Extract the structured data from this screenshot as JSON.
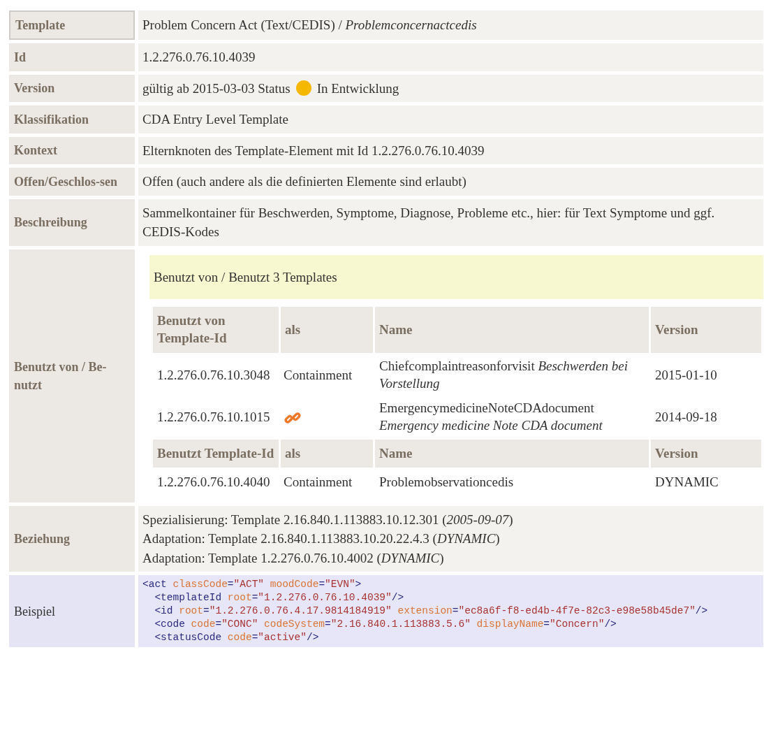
{
  "rows": [
    {
      "kind": "text",
      "label": "Template",
      "text": "Problem Concern Act (Text/CEDIS) / *Problemconcernactcedis*"
    },
    {
      "kind": "text",
      "label": "Id",
      "text": "1.2.276.0.76.10.4039"
    },
    {
      "kind": "status",
      "label": "Version",
      "before": "gültig ab 2015-03-03 Status",
      "color": "#f5b800",
      "after": "In Entwicklung"
    },
    {
      "kind": "text",
      "label": "Klassifikation",
      "text": "CDA Entry Level Template"
    },
    {
      "kind": "text",
      "label": "Kontext",
      "text": "Elternknoten des Template-Element mit Id 1.2.276.0.76.10.4039"
    },
    {
      "kind": "text",
      "label": "Offen/Geschlos-sen",
      "text": "Offen (auch andere als die definierten Elemente sind erlaubt)"
    },
    {
      "kind": "text",
      "label": "Beschreibung",
      "text": "Sammelkontainer für Beschwerden, Symptome, Diagnose, Probleme etc., hier: für Text Symptome und ggf. CEDIS-Kodes"
    },
    {
      "kind": "usage",
      "label": "Benutzt von / Be-nutzt",
      "title": "Benutzt von / Benutzt 3 Templates",
      "groups": [
        {
          "columns": [
            "Benutzt von Template-Id",
            "als",
            "Name",
            "Version"
          ],
          "rows": [
            {
              "id": "1.2.276.0.76.10.3048",
              "as": {
                "kind": "text",
                "text": "Containment"
              },
              "name": "Chiefcomplaintreasonforvisit *Beschwerden bei Vorstellung*",
              "version": "2015-01-10"
            },
            {
              "id": "1.2.276.0.76.10.1015",
              "as": {
                "kind": "link-icon"
              },
              "name": "EmergencymedicineNoteCDAdocument *Emergency medicine Note CDA document*",
              "version": "2014-09-18"
            }
          ]
        },
        {
          "columns": [
            "Benutzt Template-Id",
            "als",
            "Name",
            "Version"
          ],
          "rows": [
            {
              "id": "1.2.276.0.76.10.4040",
              "as": {
                "kind": "text",
                "text": "Containment"
              },
              "name": "Problemobservationcedis",
              "version": "DYNAMIC"
            }
          ]
        }
      ]
    },
    {
      "kind": "lines",
      "label": "Beziehung",
      "lines": [
        "Spezialisierung: Template 2.16.840.1.113883.10.12.301 (*2005-09-07*)",
        "Adaptation: Template 2.16.840.1.113883.10.20.22.4.3 (*DYNAMIC*)",
        "Adaptation: Template 1.2.276.0.76.10.4002 (*DYNAMIC*)"
      ]
    },
    {
      "kind": "code",
      "label": "Beispiel",
      "code": [
        [
          {
            "kind": "tag",
            "s": "<act"
          },
          {
            "kind": "attr",
            "s": " classCode"
          },
          {
            "kind": "tag",
            "s": "="
          },
          {
            "kind": "val",
            "s": "\"ACT\""
          },
          {
            "kind": "attr",
            "s": " moodCode"
          },
          {
            "kind": "tag",
            "s": "="
          },
          {
            "kind": "val",
            "s": "\"EVN\""
          },
          {
            "kind": "tag",
            "s": ">"
          }
        ],
        [
          {
            "kind": "tag",
            "s": "  <templateId"
          },
          {
            "kind": "attr",
            "s": " root"
          },
          {
            "kind": "tag",
            "s": "="
          },
          {
            "kind": "val",
            "s": "\"1.2.276.0.76.10.4039\""
          },
          {
            "kind": "tag",
            "s": "/>"
          }
        ],
        [
          {
            "kind": "tag",
            "s": "  <id"
          },
          {
            "kind": "attr",
            "s": " root"
          },
          {
            "kind": "tag",
            "s": "="
          },
          {
            "kind": "val",
            "s": "\"1.2.276.0.76.4.17.9814184919\""
          },
          {
            "kind": "attr",
            "s": " extension"
          },
          {
            "kind": "tag",
            "s": "="
          },
          {
            "kind": "val",
            "s": "\"ec8a6f-f8-ed4b-4f7e-82c3-e98e58b45de7\""
          },
          {
            "kind": "tag",
            "s": "/>"
          }
        ],
        [
          {
            "kind": "tag",
            "s": "  <code"
          },
          {
            "kind": "attr",
            "s": " code"
          },
          {
            "kind": "tag",
            "s": "="
          },
          {
            "kind": "val",
            "s": "\"CONC\""
          },
          {
            "kind": "attr",
            "s": " codeSystem"
          },
          {
            "kind": "tag",
            "s": "="
          },
          {
            "kind": "val",
            "s": "\"2.16.840.1.113883.5.6\""
          },
          {
            "kind": "attr",
            "s": " displayName"
          },
          {
            "kind": "tag",
            "s": "="
          },
          {
            "kind": "val",
            "s": "\"Concern\""
          },
          {
            "kind": "tag",
            "s": "/>"
          }
        ],
        [
          {
            "kind": "tag",
            "s": "  <statusCode"
          },
          {
            "kind": "attr",
            "s": " code"
          },
          {
            "kind": "tag",
            "s": "="
          },
          {
            "kind": "val",
            "s": "\"active\""
          },
          {
            "kind": "tag",
            "s": "/>"
          }
        ]
      ]
    }
  ]
}
